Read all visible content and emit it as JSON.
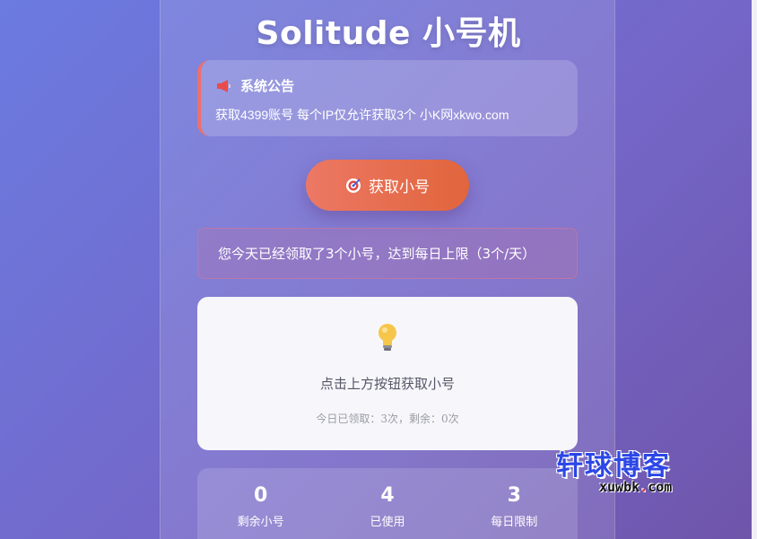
{
  "title": "Solitude 小号机",
  "notice": {
    "heading": "系统公告",
    "text": "获取4399账号 每个IP仅允许获取3个 小K网xkwo.com"
  },
  "get_button": {
    "label": "获取小号"
  },
  "limit_message": "您今天已经领取了3个小号，达到每日上限（3个/天）",
  "result": {
    "hint": "点击上方按钮获取小号",
    "sub": "今日已领取：3次，剩余：0次"
  },
  "stats": [
    {
      "value": "0",
      "label": "剩余小号"
    },
    {
      "value": "4",
      "label": "已使用"
    },
    {
      "value": "3",
      "label": "每日限制"
    }
  ],
  "watermark": {
    "title": "轩球博客",
    "url_prefix": "xuwbk",
    "url_dot": ".",
    "url_suffix": "com"
  },
  "colors": {
    "accent": "#e1653c",
    "notice_border": "#ef6f6a",
    "watermark": "#2c47e6"
  }
}
